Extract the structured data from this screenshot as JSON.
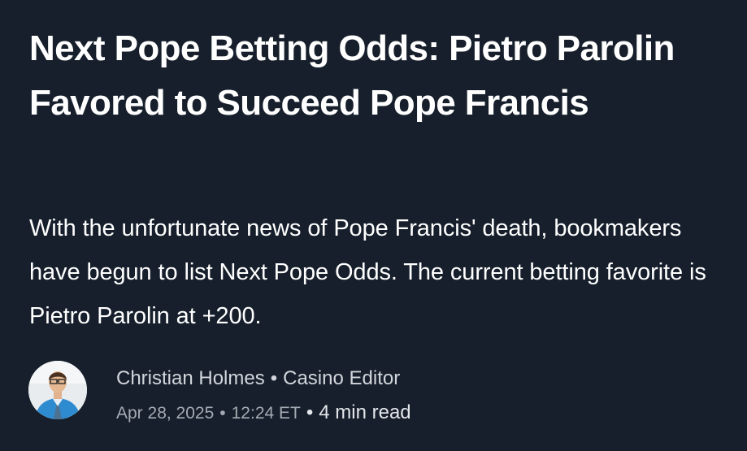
{
  "article": {
    "title": "Next Pope Betting Odds: Pietro Parolin Favored to Succeed Pope Francis",
    "dek": "With the unfortunate news of Pope Francis' death, bookmakers have begun to list Next Pope Odds. The current betting favorite is Pietro Parolin at +200."
  },
  "byline": {
    "author_name": "Christian Holmes",
    "separator": "•",
    "author_role": "Casino Editor",
    "date": "Apr 28, 2025",
    "time": "12:24 ET",
    "read_time": "4 min read"
  },
  "colors": {
    "background": "#161f2b",
    "headline": "#ffffff",
    "meta": "#a4aab3"
  }
}
